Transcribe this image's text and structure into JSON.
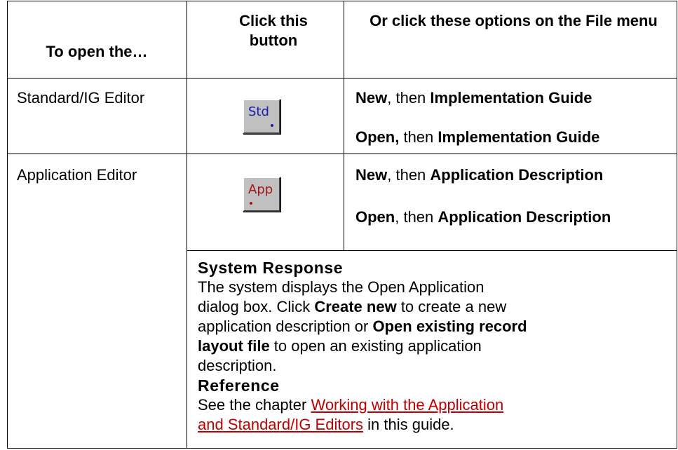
{
  "headers": {
    "col1": "To open the…",
    "col2": "Click this button",
    "col3": "Or click these options on the File menu"
  },
  "rows": [
    {
      "label": "Standard/IG Editor",
      "button_label": "Std",
      "option1": {
        "a": "New",
        "sep": ", then ",
        "b": "Implementation Guide"
      },
      "option2": {
        "a": "Open,",
        "sep": " then ",
        "b": "Implementation Guide"
      }
    },
    {
      "label": "Application Editor",
      "button_label": "App",
      "option1": {
        "a": "New",
        "sep": ", then ",
        "b": "Application Description"
      },
      "option2": {
        "a": "Open",
        "sep": ", then ",
        "b": "Application Description"
      }
    }
  ],
  "system_response": {
    "heading": "System Response",
    "t1": "The system displays the Open Application dialog box. Click ",
    "b1": "Create new",
    "t2": " to create a new application description or ",
    "b2": "Open existing record layout file",
    "t3": " to open an existing application description."
  },
  "reference": {
    "heading": "Reference",
    "t1": "See the chapter ",
    "link": "Working with the Application and Standard/IG Editors",
    "t2": "  in this guide."
  },
  "colors": {
    "std_text": "#1a1ab0",
    "app_text": "#a01818",
    "link": "#c00000",
    "button_face": "#c0c0c0"
  },
  "icons": [
    "std-button-icon",
    "app-button-icon"
  ]
}
